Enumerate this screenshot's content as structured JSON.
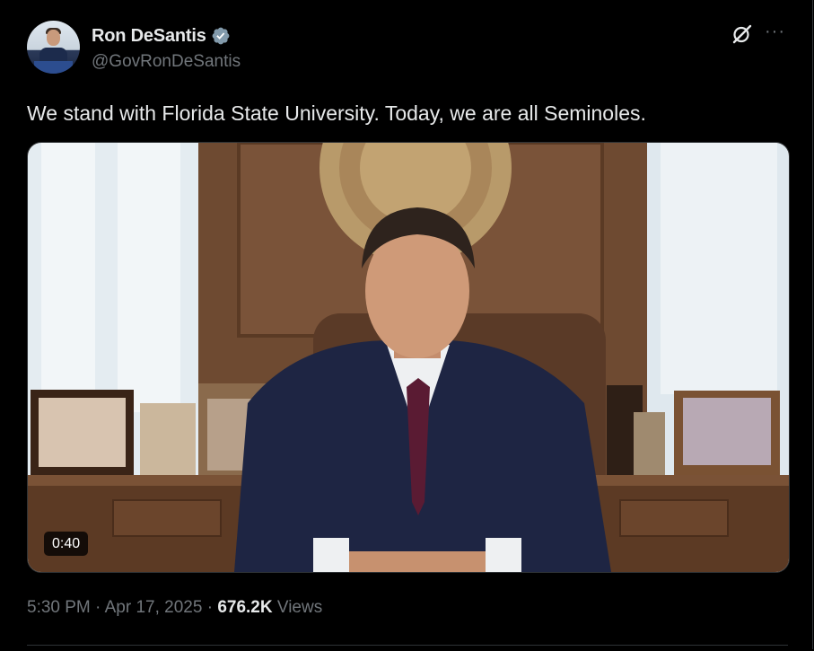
{
  "author": {
    "display_name": "Ron DeSantis",
    "handle": "@GovRonDeSantis",
    "verified_icon": "verified-badge-icon",
    "verified_color": "#829aab"
  },
  "header_actions": {
    "grok_icon": "grok-icon",
    "more_icon": "more-icon",
    "more_label": "···"
  },
  "tweet": {
    "text": "We stand with Florida State University. Today, we are all Seminoles.",
    "video_duration": "0:40"
  },
  "meta": {
    "time": "5:30 PM",
    "separator": "·",
    "date": "Apr 17, 2025",
    "views_count": "676.2K",
    "views_label": "Views"
  },
  "colors": {
    "background": "#000000",
    "primary_text": "#e7e9ea",
    "secondary_text": "#71767b",
    "border": "#2f3336"
  }
}
